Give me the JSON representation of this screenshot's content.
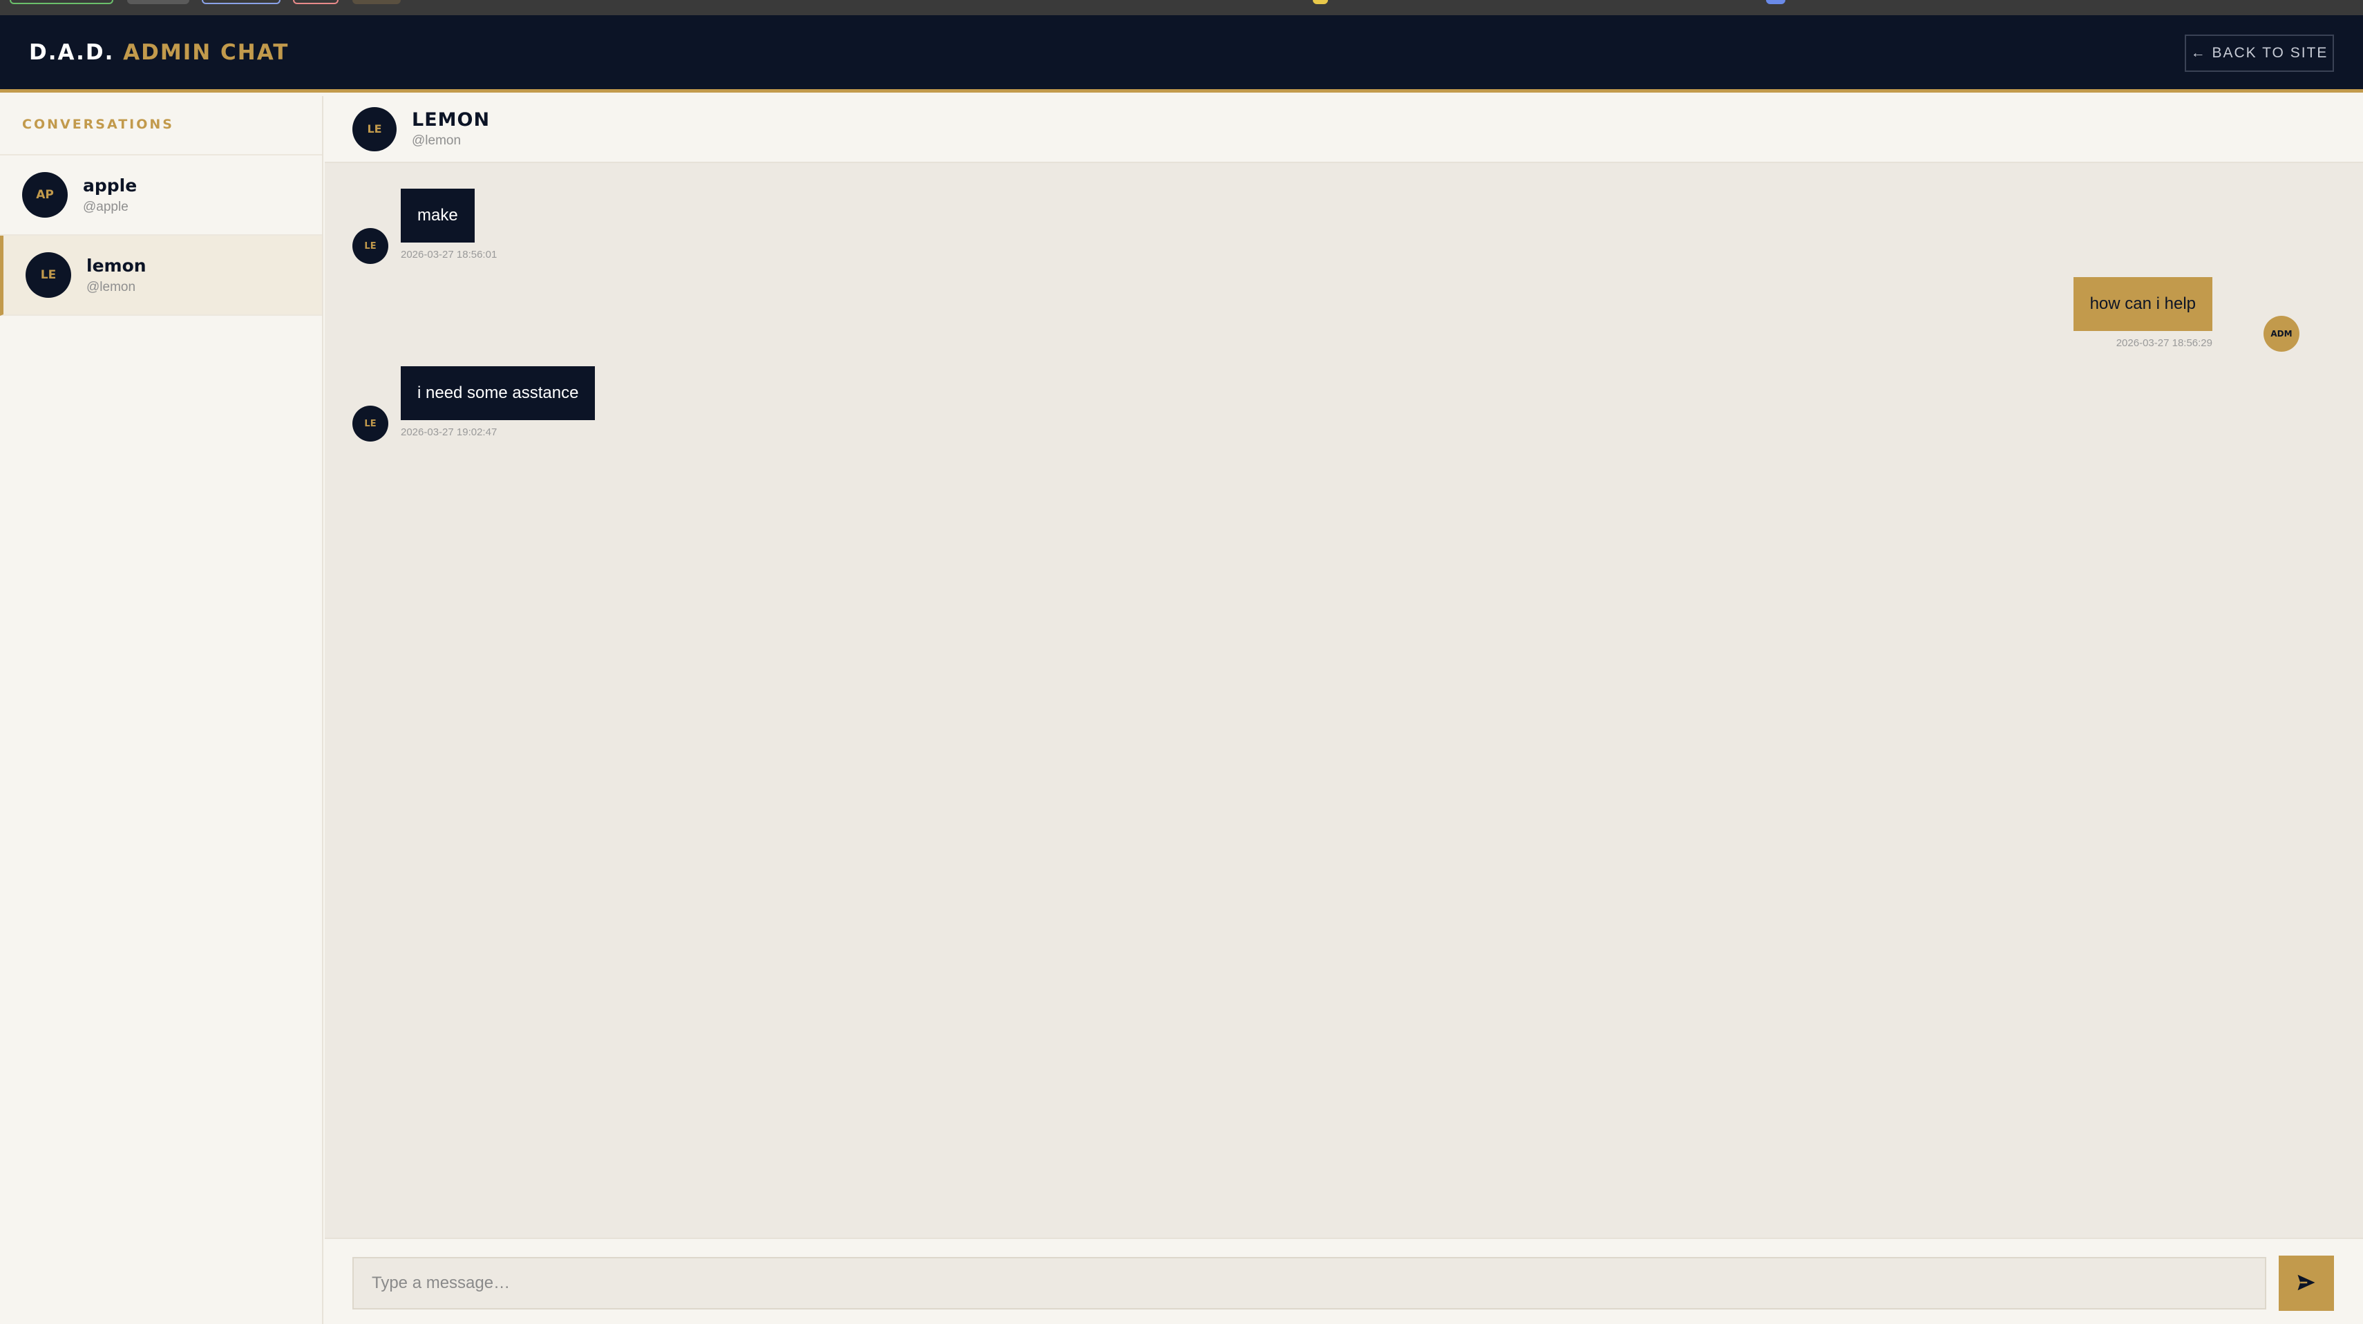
{
  "header": {
    "brand_prefix": "D.A.D.",
    "brand_accent": "ADMIN CHAT",
    "back_label": "← BACK TO SITE"
  },
  "sidebar": {
    "title": "CONVERSATIONS",
    "conversations": [
      {
        "initials": "AP",
        "name": "apple",
        "handle": "@apple",
        "active": false
      },
      {
        "initials": "LE",
        "name": "lemon",
        "handle": "@lemon",
        "active": true
      }
    ]
  },
  "chat": {
    "initials": "LE",
    "name": "LEMON",
    "handle": "@lemon",
    "messages": [
      {
        "direction": "in",
        "initials": "LE",
        "text": "make",
        "timestamp": "2026-03-27 18:56:01"
      },
      {
        "direction": "out",
        "initials": "ADM",
        "text": "how can i help",
        "timestamp": "2026-03-27 18:56:29"
      },
      {
        "direction": "in",
        "initials": "LE",
        "text": "i need some asstance",
        "timestamp": "2026-03-27 19:02:47"
      }
    ]
  },
  "composer": {
    "placeholder": "Type a message…",
    "send_icon": "send-icon"
  },
  "colors": {
    "navy": "#0c1426",
    "gold": "#c29a4c",
    "chat_bg": "#ede9e2",
    "panel_bg": "#f7f5f0"
  }
}
